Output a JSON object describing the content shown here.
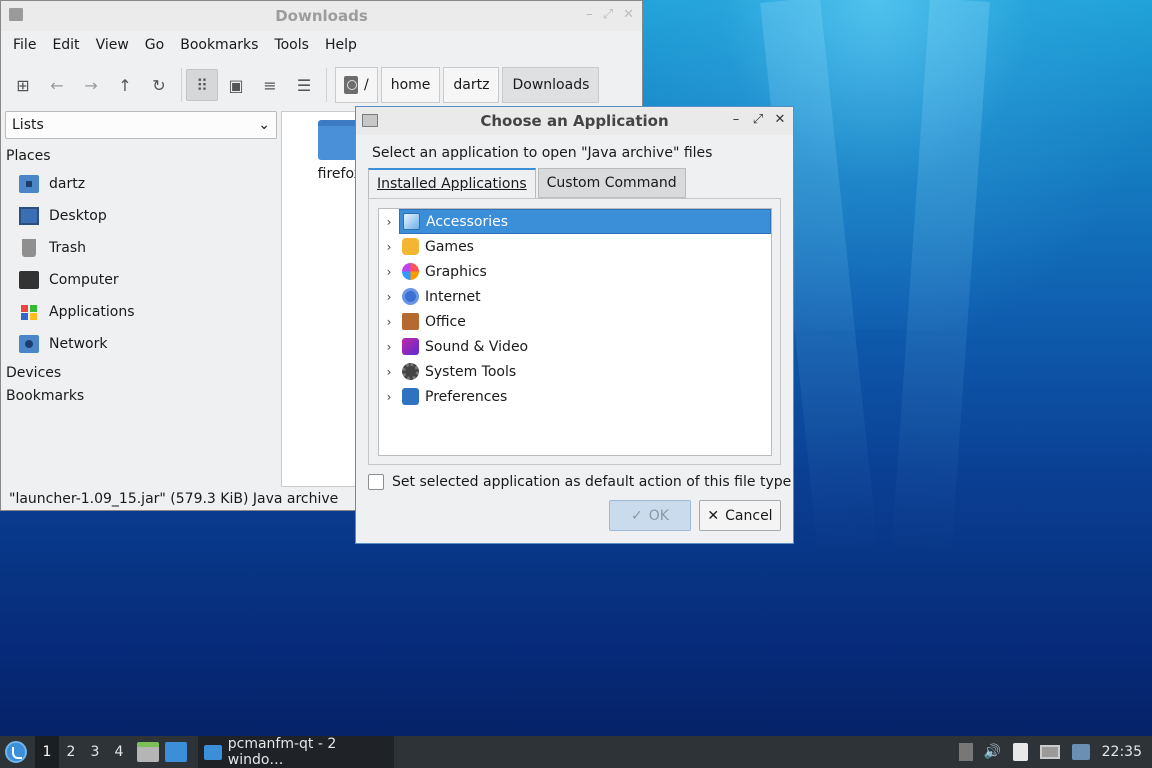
{
  "file_manager": {
    "title": "Downloads",
    "menu": [
      "File",
      "Edit",
      "View",
      "Go",
      "Bookmarks",
      "Tools",
      "Help"
    ],
    "path": [
      "/",
      "home",
      "dartz",
      "Downloads"
    ],
    "sidebar_mode": "Lists",
    "places_label": "Places",
    "places": [
      "dartz",
      "Desktop",
      "Trash",
      "Computer",
      "Applications",
      "Network"
    ],
    "devices_label": "Devices",
    "bookmarks_label": "Bookmarks",
    "file_item_name": "firefox.",
    "status": "\"launcher-1.09_15.jar\" (579.3 KiB) Java archive"
  },
  "dialog": {
    "title": "Choose an Application",
    "prompt": "Select an application to open \"Java archive\" files",
    "tabs": [
      "Installed Applications",
      "Custom Command"
    ],
    "categories": [
      "Accessories",
      "Games",
      "Graphics",
      "Internet",
      "Office",
      "Sound & Video",
      "System Tools",
      "Preferences"
    ],
    "selected_category": "Accessories",
    "default_checkbox_label": "Set selected application as default action of this file type",
    "default_checked": false,
    "ok_label": "OK",
    "cancel_label": "Cancel"
  },
  "taskbar": {
    "desktops": [
      "1",
      "2",
      "3",
      "4"
    ],
    "active_desktop": "1",
    "task_label": "pcmanfm-qt - 2 windo…",
    "clock": "22:35"
  },
  "colors": {
    "accent": "#3b8ed8",
    "taskbar_bg": "#2e3338",
    "selection_text": "#ffffff"
  }
}
